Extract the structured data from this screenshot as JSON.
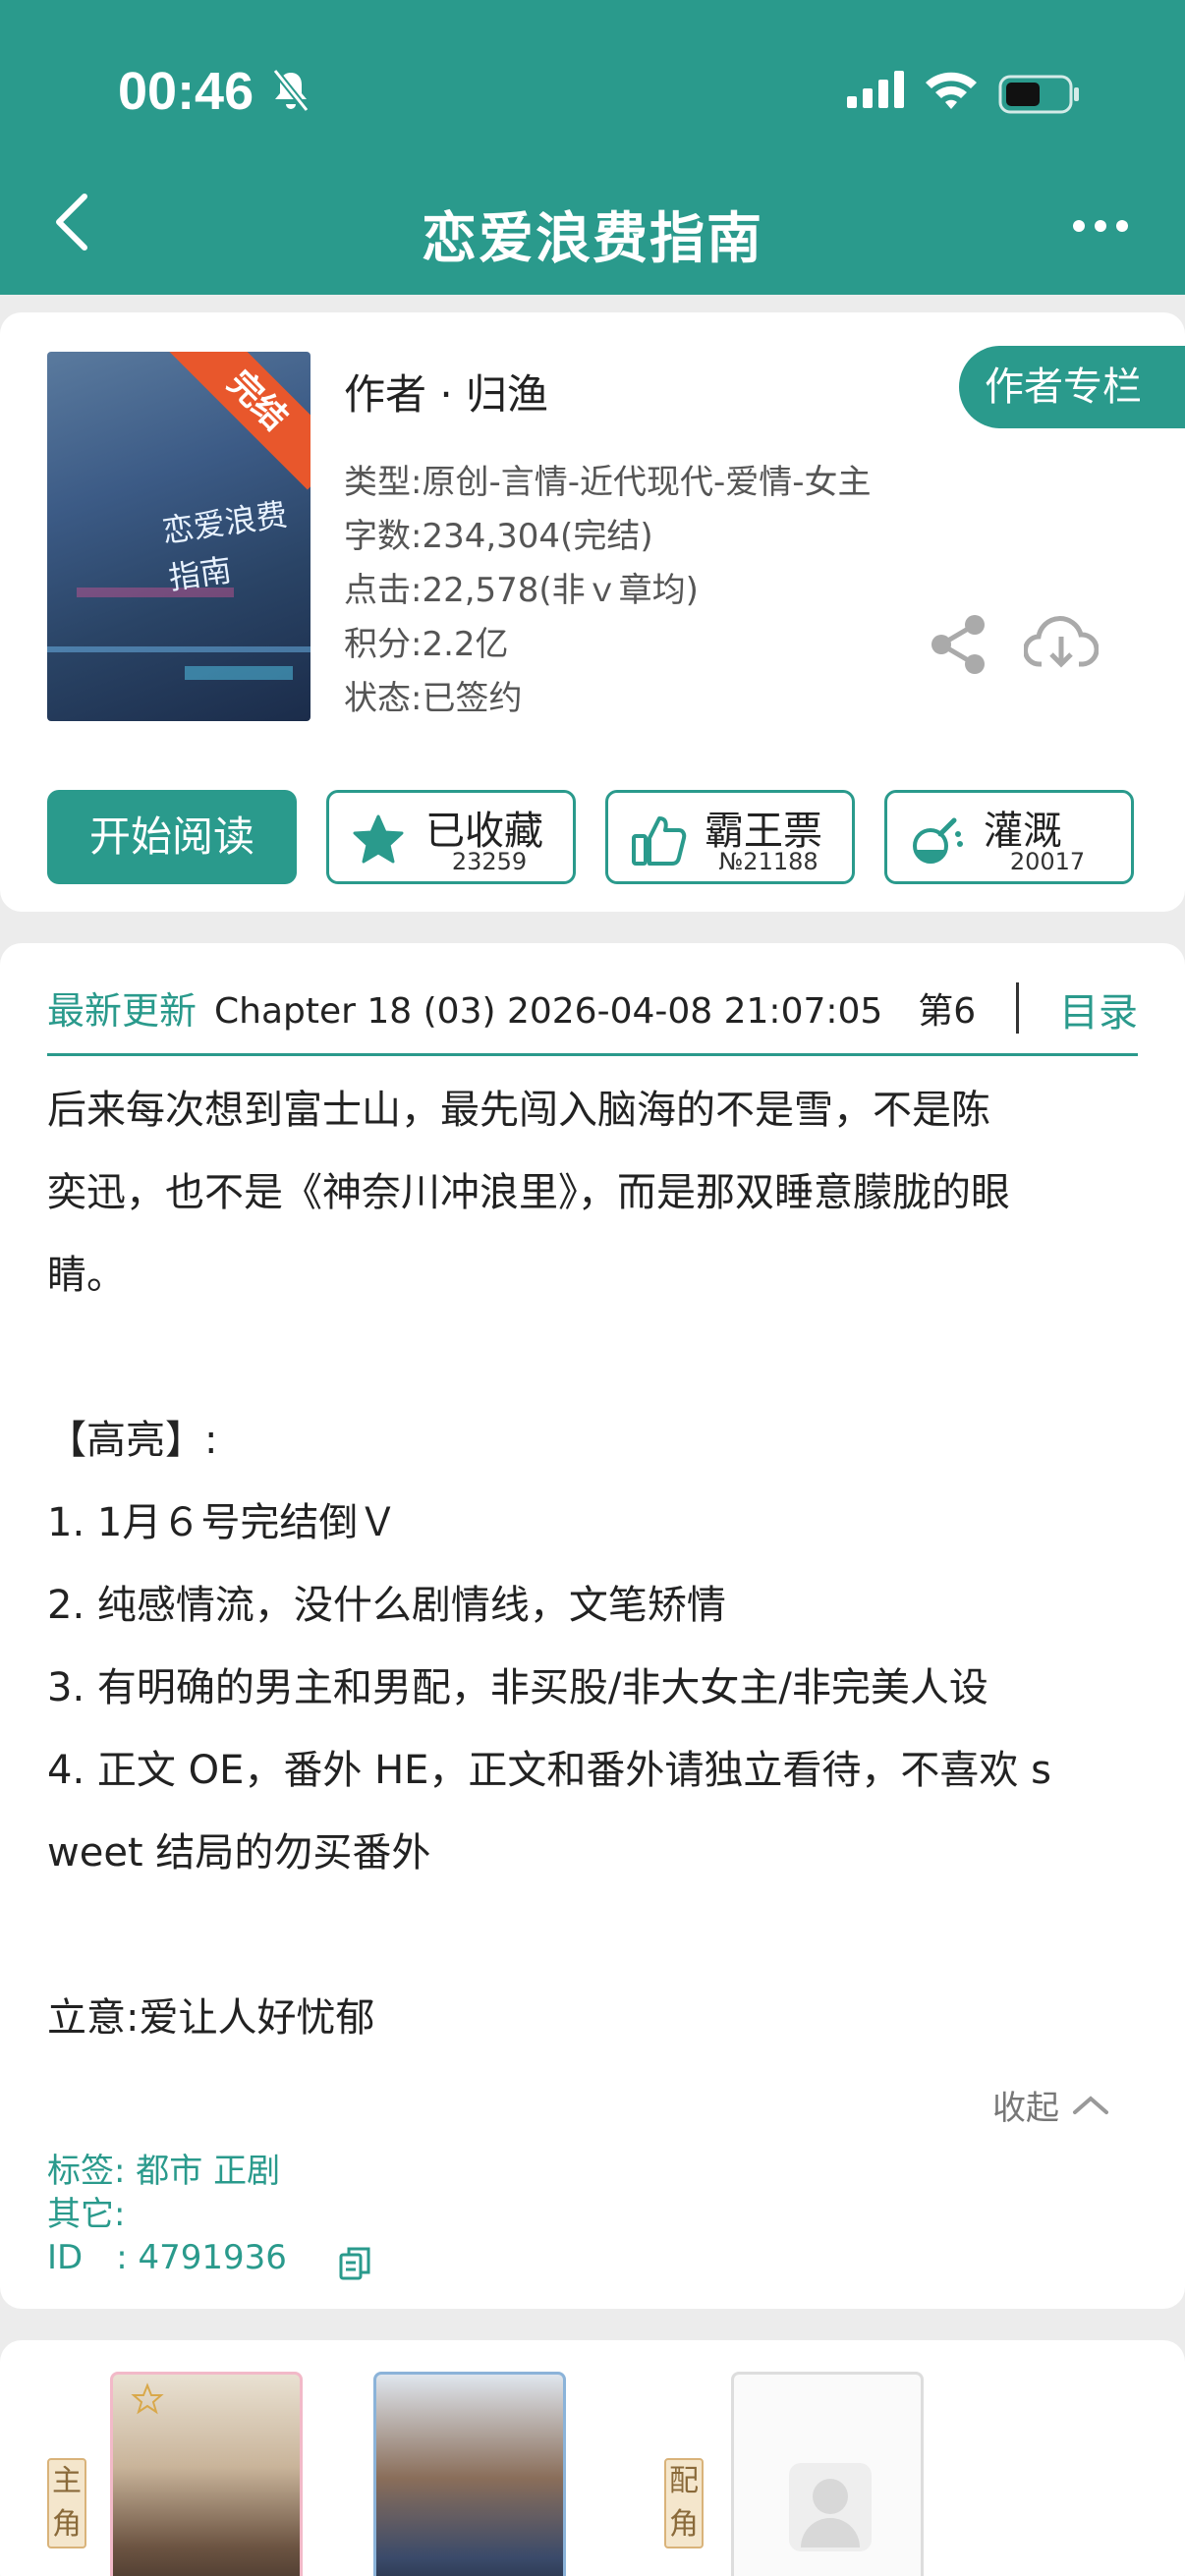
{
  "status": {
    "time": "00:46"
  },
  "nav": {
    "title": "恋爱浪费指南"
  },
  "book": {
    "ribbon": "完结",
    "author": "作者 · 归渔",
    "author_button": "作者专栏",
    "meta": [
      "类型:原创-言情-近代现代-爱情-女主",
      "字数:234,304(完结)",
      "点击:22,578(非ｖ章均)",
      "积分:2.2亿",
      "状态:已签约"
    ]
  },
  "actions": {
    "read": "开始阅读",
    "favorite": {
      "label": "已收藏",
      "count": "23259"
    },
    "ticket": {
      "label": "霸王票",
      "count": "№21188"
    },
    "water": {
      "label": "灌溉",
      "count": "20017"
    }
  },
  "latest": {
    "label": "最新更新",
    "text": "Chapter 18 (03) 2026-04-08 21:07:05　第6",
    "toc": "目录"
  },
  "description": [
    "后来每次想到富士山，最先闯入脑海的不是雪，不是陈",
    "奕迅，也不是《神奈川冲浪里》，而是那双睡意朦胧的眼",
    "睛。",
    "",
    "【高亮】:",
    "1. 1月６号完结倒Ｖ",
    "2. 纯感情流，没什么剧情线，文笔矫情",
    "3. 有明确的男主和男配，非买股/非大女主/非完美人设",
    "4. 正文 OE，番外 HE，正文和番外请独立看待，不喜欢 s",
    "weet 结局的勿买番外",
    "",
    "立意:爱让人好忧郁"
  ],
  "collapse": "收起",
  "tags": {
    "tag_line": "标签: 都市  正剧",
    "other": "其它:",
    "id": "ID　:  4791936"
  },
  "roles": {
    "main": "主角",
    "supporting": "配角"
  },
  "colors": {
    "accent": "#2a9a8c",
    "ribbon": "#e8572c"
  }
}
